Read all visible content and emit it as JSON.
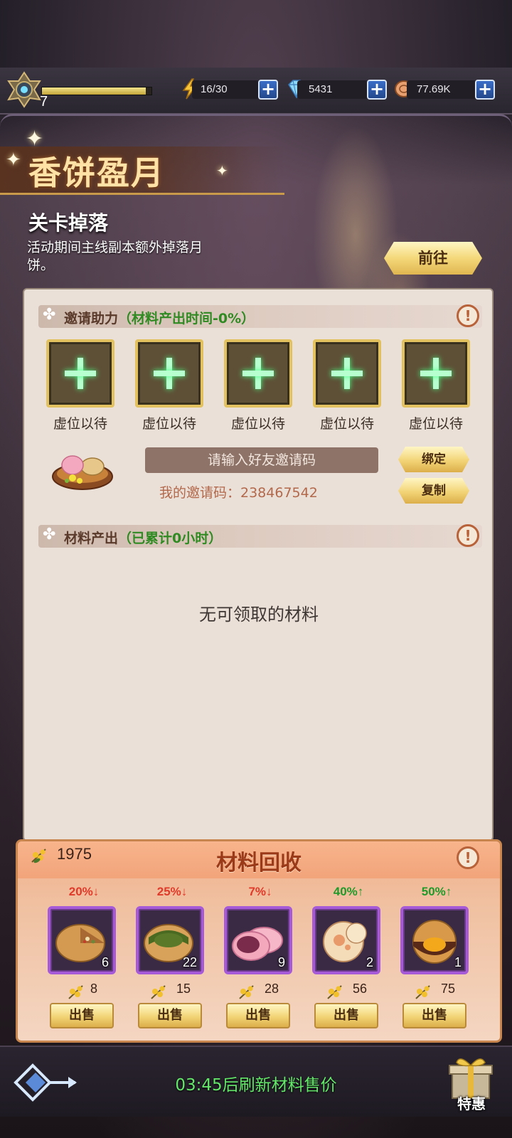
{
  "topbar": {
    "level": "7",
    "exp_fraction": 0.95,
    "energy": "16/30",
    "diamonds": "5431",
    "coins": "77.69K",
    "plus_label": "+"
  },
  "event": {
    "title": "香饼盈月",
    "subtitle": "关卡掉落",
    "description": "活动期间主线副本额外掉落月饼。",
    "goto_label": "前往"
  },
  "invite": {
    "section_title": "邀请助力",
    "section_note": "（材料产出时间-0%）",
    "info_icon": "!",
    "slots": [
      {
        "label": "虚位以待"
      },
      {
        "label": "虚位以待"
      },
      {
        "label": "虚位以待"
      },
      {
        "label": "虚位以待"
      },
      {
        "label": "虚位以待"
      }
    ],
    "input_placeholder": "请输入好友邀请码",
    "my_code": "我的邀请码：238467542",
    "bind_label": "绑定",
    "copy_label": "复制"
  },
  "materials": {
    "section_title": "材料产出",
    "section_note": "（已累计0小时）",
    "empty_message": "无可领取的材料"
  },
  "recycle": {
    "title": "材料回收",
    "currency_total": "1975",
    "items": [
      {
        "pct": "20%↓",
        "trend": "down",
        "count": "6",
        "price": "8",
        "sell_label": "出售",
        "icon": "five-kernel-mooncake-icon"
      },
      {
        "pct": "25%↓",
        "trend": "down",
        "count": "22",
        "price": "15",
        "sell_label": "出售",
        "icon": "matcha-mooncake-icon"
      },
      {
        "pct": "7%↓",
        "trend": "down",
        "count": "9",
        "price": "28",
        "sell_label": "出售",
        "icon": "snowskin-mooncake-icon"
      },
      {
        "pct": "40%↑",
        "trend": "up",
        "count": "2",
        "price": "56",
        "sell_label": "出售",
        "icon": "flaky-mooncake-icon"
      },
      {
        "pct": "50%↑",
        "trend": "up",
        "count": "1",
        "price": "75",
        "sell_label": "出售",
        "icon": "egg-yolk-mooncake-icon"
      }
    ]
  },
  "footer": {
    "refresh_text": "03:45后刷新材料售价",
    "gift_label": "特惠"
  },
  "colors": {
    "accent_gold": "#e2c260",
    "slot_purple": "#a65ad8",
    "up_green": "#1f9a2a",
    "down_red": "#e03a2a",
    "timer_green": "#64e86a"
  }
}
